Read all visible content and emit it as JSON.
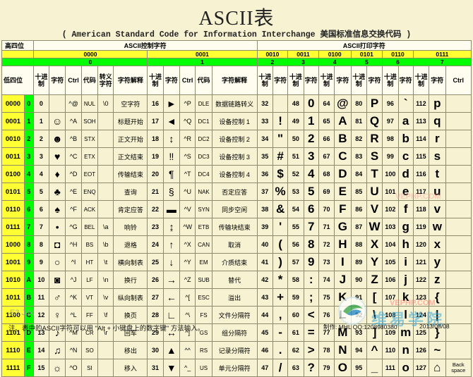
{
  "title": "ASCII表",
  "subtitle": "( American Standard Code for Information Interchange  美国标准信息交换代码 )",
  "corner_high": "高四位",
  "corner_low": "低四位",
  "group_control": "ASCII控制字符",
  "group_print": "ASCII打印字符",
  "high_bits": [
    "0000",
    "0001",
    "0010",
    "0011",
    "0100",
    "0101",
    "0110",
    "0111"
  ],
  "high_hex": [
    "0",
    "1",
    "2",
    "3",
    "4",
    "5",
    "6",
    "7"
  ],
  "col_headers": {
    "dec": "十进制",
    "char": "字符",
    "ctrl": "Ctrl",
    "code": "代码",
    "esc": "转义字符",
    "desc": "字符解释"
  },
  "rows": [
    {
      "bits": "0000",
      "hex": "0",
      "c0": {
        "dec": "0",
        "char": "",
        "ctrl": "^@",
        "code": "NUL",
        "esc": "\\0",
        "desc": "空字符"
      },
      "c1": {
        "dec": "16",
        "char": "►",
        "ctrl": "^P",
        "code": "DLE",
        "esc": "",
        "desc": "数据链路转义"
      },
      "p": [
        {
          "dec": "32",
          "char": ""
        },
        {
          "dec": "48",
          "char": "0"
        },
        {
          "dec": "64",
          "char": "@"
        },
        {
          "dec": "80",
          "char": "P"
        },
        {
          "dec": "96",
          "char": "`"
        },
        {
          "dec": "112",
          "char": "p"
        }
      ]
    },
    {
      "bits": "0001",
      "hex": "1",
      "c0": {
        "dec": "1",
        "char": "☺",
        "ctrl": "^A",
        "code": "SOH",
        "esc": "",
        "desc": "标题开始"
      },
      "c1": {
        "dec": "17",
        "char": "◄",
        "ctrl": "^Q",
        "code": "DC1",
        "esc": "",
        "desc": "设备控制 1"
      },
      "p": [
        {
          "dec": "33",
          "char": "!"
        },
        {
          "dec": "49",
          "char": "1"
        },
        {
          "dec": "65",
          "char": "A"
        },
        {
          "dec": "81",
          "char": "Q"
        },
        {
          "dec": "97",
          "char": "a"
        },
        {
          "dec": "113",
          "char": "q"
        }
      ]
    },
    {
      "bits": "0010",
      "hex": "2",
      "c0": {
        "dec": "2",
        "char": "☻",
        "ctrl": "^B",
        "code": "STX",
        "esc": "",
        "desc": "正文开始"
      },
      "c1": {
        "dec": "18",
        "char": "↕",
        "ctrl": "^R",
        "code": "DC2",
        "esc": "",
        "desc": "设备控制 2"
      },
      "p": [
        {
          "dec": "34",
          "char": "\""
        },
        {
          "dec": "50",
          "char": "2"
        },
        {
          "dec": "66",
          "char": "B"
        },
        {
          "dec": "82",
          "char": "R"
        },
        {
          "dec": "98",
          "char": "b"
        },
        {
          "dec": "114",
          "char": "r"
        }
      ]
    },
    {
      "bits": "0011",
      "hex": "3",
      "c0": {
        "dec": "3",
        "char": "♥",
        "ctrl": "^C",
        "code": "ETX",
        "esc": "",
        "desc": "正文结束"
      },
      "c1": {
        "dec": "19",
        "char": "‼",
        "ctrl": "^S",
        "code": "DC3",
        "esc": "",
        "desc": "设备控制 3"
      },
      "p": [
        {
          "dec": "35",
          "char": "#"
        },
        {
          "dec": "51",
          "char": "3"
        },
        {
          "dec": "67",
          "char": "C"
        },
        {
          "dec": "83",
          "char": "S"
        },
        {
          "dec": "99",
          "char": "c"
        },
        {
          "dec": "115",
          "char": "s"
        }
      ]
    },
    {
      "bits": "0100",
      "hex": "4",
      "c0": {
        "dec": "4",
        "char": "♦",
        "ctrl": "^D",
        "code": "EOT",
        "esc": "",
        "desc": "传输结束"
      },
      "c1": {
        "dec": "20",
        "char": "¶",
        "ctrl": "^T",
        "code": "DC4",
        "esc": "",
        "desc": "设备控制 4"
      },
      "p": [
        {
          "dec": "36",
          "char": "$"
        },
        {
          "dec": "52",
          "char": "4"
        },
        {
          "dec": "68",
          "char": "D"
        },
        {
          "dec": "84",
          "char": "T"
        },
        {
          "dec": "100",
          "char": "d"
        },
        {
          "dec": "116",
          "char": "t"
        }
      ]
    },
    {
      "bits": "0101",
      "hex": "5",
      "c0": {
        "dec": "5",
        "char": "♣",
        "ctrl": "^E",
        "code": "ENQ",
        "esc": "",
        "desc": "查询"
      },
      "c1": {
        "dec": "21",
        "char": "§",
        "ctrl": "^U",
        "code": "NAK",
        "esc": "",
        "desc": "否定应答"
      },
      "p": [
        {
          "dec": "37",
          "char": "%"
        },
        {
          "dec": "53",
          "char": "5"
        },
        {
          "dec": "69",
          "char": "E"
        },
        {
          "dec": "85",
          "char": "U"
        },
        {
          "dec": "101",
          "char": "e"
        },
        {
          "dec": "117",
          "char": "u"
        }
      ]
    },
    {
      "bits": "0110",
      "hex": "6",
      "c0": {
        "dec": "6",
        "char": "♠",
        "ctrl": "^F",
        "code": "ACK",
        "esc": "",
        "desc": "肯定应答"
      },
      "c1": {
        "dec": "22",
        "char": "▬",
        "ctrl": "^V",
        "code": "SYN",
        "esc": "",
        "desc": "同步空闲"
      },
      "p": [
        {
          "dec": "38",
          "char": "&"
        },
        {
          "dec": "54",
          "char": "6"
        },
        {
          "dec": "70",
          "char": "F"
        },
        {
          "dec": "86",
          "char": "V"
        },
        {
          "dec": "102",
          "char": "f"
        },
        {
          "dec": "118",
          "char": "v"
        }
      ]
    },
    {
      "bits": "0111",
      "hex": "7",
      "c0": {
        "dec": "7",
        "char": "•",
        "ctrl": "^G",
        "code": "BEL",
        "esc": "\\a",
        "desc": "响铃"
      },
      "c1": {
        "dec": "23",
        "char": "↨",
        "ctrl": "^W",
        "code": "ETB",
        "esc": "",
        "desc": "传输块结束"
      },
      "p": [
        {
          "dec": "39",
          "char": "'"
        },
        {
          "dec": "55",
          "char": "7"
        },
        {
          "dec": "71",
          "char": "G"
        },
        {
          "dec": "87",
          "char": "W"
        },
        {
          "dec": "103",
          "char": "g"
        },
        {
          "dec": "119",
          "char": "w"
        }
      ]
    },
    {
      "bits": "1000",
      "hex": "8",
      "c0": {
        "dec": "8",
        "char": "◘",
        "ctrl": "^H",
        "code": "BS",
        "esc": "\\b",
        "desc": "退格"
      },
      "c1": {
        "dec": "24",
        "char": "↑",
        "ctrl": "^X",
        "code": "CAN",
        "esc": "",
        "desc": "取消"
      },
      "p": [
        {
          "dec": "40",
          "char": "("
        },
        {
          "dec": "56",
          "char": "8"
        },
        {
          "dec": "72",
          "char": "H"
        },
        {
          "dec": "88",
          "char": "X"
        },
        {
          "dec": "104",
          "char": "h"
        },
        {
          "dec": "120",
          "char": "x"
        }
      ]
    },
    {
      "bits": "1001",
      "hex": "9",
      "c0": {
        "dec": "9",
        "char": "○",
        "ctrl": "^I",
        "code": "HT",
        "esc": "\\t",
        "desc": "横向制表"
      },
      "c1": {
        "dec": "25",
        "char": "↓",
        "ctrl": "^Y",
        "code": "EM",
        "esc": "",
        "desc": "介质结束"
      },
      "p": [
        {
          "dec": "41",
          "char": ")"
        },
        {
          "dec": "57",
          "char": "9"
        },
        {
          "dec": "73",
          "char": "I"
        },
        {
          "dec": "89",
          "char": "Y"
        },
        {
          "dec": "105",
          "char": "i"
        },
        {
          "dec": "121",
          "char": "y"
        }
      ]
    },
    {
      "bits": "1010",
      "hex": "A",
      "c0": {
        "dec": "10",
        "char": "◙",
        "ctrl": "^J",
        "code": "LF",
        "esc": "\\n",
        "desc": "换行"
      },
      "c1": {
        "dec": "26",
        "char": "→",
        "ctrl": "^Z",
        "code": "SUB",
        "esc": "",
        "desc": "替代"
      },
      "p": [
        {
          "dec": "42",
          "char": "*"
        },
        {
          "dec": "58",
          "char": ":"
        },
        {
          "dec": "74",
          "char": "J"
        },
        {
          "dec": "90",
          "char": "Z"
        },
        {
          "dec": "106",
          "char": "j"
        },
        {
          "dec": "122",
          "char": "z"
        }
      ]
    },
    {
      "bits": "1011",
      "hex": "B",
      "c0": {
        "dec": "11",
        "char": "♂",
        "ctrl": "^K",
        "code": "VT",
        "esc": "\\v",
        "desc": "纵向制表"
      },
      "c1": {
        "dec": "27",
        "char": "←",
        "ctrl": "^[",
        "code": "ESC",
        "esc": "\\e",
        "desc": "溢出"
      },
      "p": [
        {
          "dec": "43",
          "char": "+"
        },
        {
          "dec": "59",
          "char": ";"
        },
        {
          "dec": "75",
          "char": "K"
        },
        {
          "dec": "91",
          "char": "["
        },
        {
          "dec": "107",
          "char": "k"
        },
        {
          "dec": "123",
          "char": "{"
        }
      ]
    },
    {
      "bits": "1100",
      "hex": "C",
      "c0": {
        "dec": "12",
        "char": "♀",
        "ctrl": "^L",
        "code": "FF",
        "esc": "\\f",
        "desc": "换页"
      },
      "c1": {
        "dec": "28",
        "char": "∟",
        "ctrl": "^\\",
        "code": "FS",
        "esc": "",
        "desc": "文件分隔符"
      },
      "p": [
        {
          "dec": "44",
          "char": ","
        },
        {
          "dec": "60",
          "char": "<"
        },
        {
          "dec": "76",
          "char": "L"
        },
        {
          "dec": "92",
          "char": "\\"
        },
        {
          "dec": "108",
          "char": "l"
        },
        {
          "dec": "124",
          "char": "|"
        }
      ]
    },
    {
      "bits": "1101",
      "hex": "D",
      "c0": {
        "dec": "13",
        "char": "♪",
        "ctrl": "^M",
        "code": "CR",
        "esc": "\\r",
        "desc": "回车"
      },
      "c1": {
        "dec": "29",
        "char": "↔",
        "ctrl": "^]",
        "code": "GS",
        "esc": "",
        "desc": "组分隔符"
      },
      "p": [
        {
          "dec": "45",
          "char": "-"
        },
        {
          "dec": "61",
          "char": "="
        },
        {
          "dec": "77",
          "char": "M"
        },
        {
          "dec": "93",
          "char": "]"
        },
        {
          "dec": "109",
          "char": "m"
        },
        {
          "dec": "125",
          "char": "}"
        }
      ]
    },
    {
      "bits": "1110",
      "hex": "E",
      "c0": {
        "dec": "14",
        "char": "♫",
        "ctrl": "^N",
        "code": "SO",
        "esc": "",
        "desc": "移出"
      },
      "c1": {
        "dec": "30",
        "char": "▲",
        "ctrl": "^^",
        "code": "RS",
        "esc": "",
        "desc": "记录分隔符"
      },
      "p": [
        {
          "dec": "46",
          "char": "."
        },
        {
          "dec": "62",
          "char": ">"
        },
        {
          "dec": "78",
          "char": "N"
        },
        {
          "dec": "94",
          "char": "^"
        },
        {
          "dec": "110",
          "char": "n"
        },
        {
          "dec": "126",
          "char": "~"
        }
      ]
    },
    {
      "bits": "1111",
      "hex": "F",
      "c0": {
        "dec": "15",
        "char": "☼",
        "ctrl": "^O",
        "code": "SI",
        "esc": "",
        "desc": "移入"
      },
      "c1": {
        "dec": "31",
        "char": "▼",
        "ctrl": "^_",
        "code": "US",
        "esc": "",
        "desc": "单元分隔符"
      },
      "p": [
        {
          "dec": "47",
          "char": "/"
        },
        {
          "dec": "63",
          "char": "?"
        },
        {
          "dec": "79",
          "char": "O"
        },
        {
          "dec": "95",
          "char": "_"
        },
        {
          "dec": "111",
          "char": "o"
        },
        {
          "dec": "127",
          "char": "⌂"
        }
      ]
    }
  ],
  "ctrl_cells": {
    "row127": "Back space",
    "row127_code": "代码: DEL"
  },
  "footer": {
    "note": "注、表中的ASCII字符可以用 \"Alt + 小键盘上的数字键\" 方法输入。",
    "author": "制作: MHL  QQ:1208980380",
    "date": "2013/08/08"
  },
  "watermarks": {
    "left": "E3 Jdk",
    "site_en": "VEPHP.COM",
    "site_cn": "维易学院"
  },
  "colors": {
    "background": "#f7f3d2",
    "bits_yellow": "#ffff33",
    "hex_green": "#00ff00"
  }
}
